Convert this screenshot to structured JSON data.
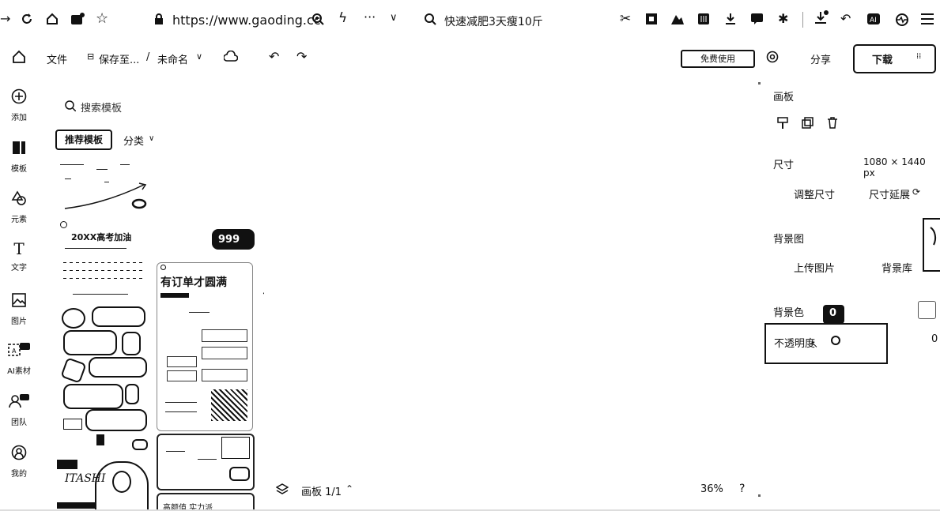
{
  "browser": {
    "url": "https://www.gaoding.cc",
    "search_text": "快速减肥3天瘦10斤"
  },
  "toolbar": {
    "file_label": "文件",
    "save_to_label": "保存至...",
    "separator": "/",
    "doc_name": "未命名",
    "vip_label": "免费使用",
    "share_label": "分享",
    "download_label": "下载"
  },
  "rail": {
    "items": [
      {
        "label": "添加",
        "icon": "plus-circle-icon"
      },
      {
        "label": "模板",
        "icon": "template-icon"
      },
      {
        "label": "元素",
        "icon": "shapes-icon"
      },
      {
        "label": "文字",
        "icon": "text-icon"
      },
      {
        "label": "图片",
        "icon": "image-icon"
      },
      {
        "label": "AI素材",
        "icon": "ai-material-icon"
      },
      {
        "label": "团队",
        "icon": "team-icon"
      },
      {
        "label": "我的",
        "icon": "user-icon"
      }
    ]
  },
  "template_panel": {
    "search_placeholder": "搜索模板",
    "tab_recommend": "推荐模板",
    "tab_category": "分类",
    "card1_title": "20XX高考加油",
    "card2_title": "有订单才圆满",
    "card3_title": "高颜值 实力派",
    "card4_title": "ITASHI",
    "price_badge": "999"
  },
  "canvas": {
    "board_label": "画板 1/1",
    "zoom": "36%",
    "help": "?"
  },
  "right_panel": {
    "board_heading": "画板",
    "size_heading": "尺寸",
    "size_value": "1080 × 1440 px",
    "resize_label": "调整尺寸",
    "extend_label": "尺寸延展",
    "bg_image_heading": "背景图",
    "upload_label": "上传图片",
    "bg_library_label": "背景库",
    "bg_color_heading": "背景色",
    "opacity_label": "不透明度",
    "opacity_value": "0",
    "tooltip_value": "0"
  }
}
